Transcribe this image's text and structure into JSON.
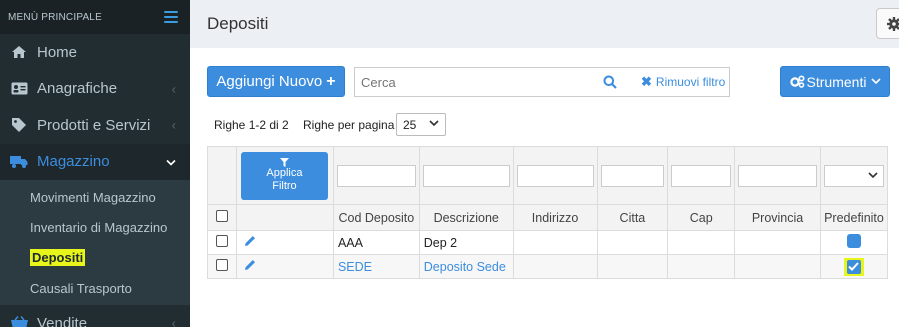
{
  "sidebar": {
    "header_title": "MENÙ PRINCIPALE",
    "items": [
      {
        "label": "Home",
        "icon": "home-icon"
      },
      {
        "label": "Anagrafiche",
        "icon": "address-card-icon"
      },
      {
        "label": "Prodotti e Servizi",
        "icon": "tag-icon"
      },
      {
        "label": "Magazzino",
        "icon": "truck-icon"
      },
      {
        "label": "Vendite",
        "icon": "basket-icon"
      }
    ],
    "submenu": [
      {
        "label": "Movimenti Magazzino"
      },
      {
        "label": "Inventario di Magazzino"
      },
      {
        "label": "Depositi"
      },
      {
        "label": "Causali Trasporto"
      }
    ]
  },
  "header": {
    "title": "Depositi"
  },
  "toolbar": {
    "add_label": "Aggiungi Nuovo",
    "search_placeholder": "Cerca",
    "remove_filter_label": "Rimuovi filtro",
    "tools_label": "Strumenti"
  },
  "pager": {
    "rows_info": "Righe 1-2 di 2",
    "rows_per_page_label": "Righe per pagina",
    "rows_per_page_value": "25"
  },
  "table": {
    "apply_filter_line1": "Applica",
    "apply_filter_line2": "Filtro",
    "columns": [
      "Cod Deposito",
      "Descrizione",
      "Indirizzo",
      "Citta",
      "Cap",
      "Provincia",
      "Predefinito"
    ],
    "rows": [
      {
        "cod": "AAA",
        "descrizione": "Dep 2",
        "indirizzo": "",
        "citta": "",
        "cap": "",
        "provincia": "",
        "predefinito": false
      },
      {
        "cod": "SEDE",
        "descrizione": "Deposito Sede",
        "indirizzo": "",
        "citta": "",
        "cap": "",
        "provincia": "",
        "predefinito": true
      }
    ]
  },
  "colors": {
    "sidebar_bg": "#222d32",
    "accent": "#3c8dde",
    "highlight": "#e8f51a"
  }
}
